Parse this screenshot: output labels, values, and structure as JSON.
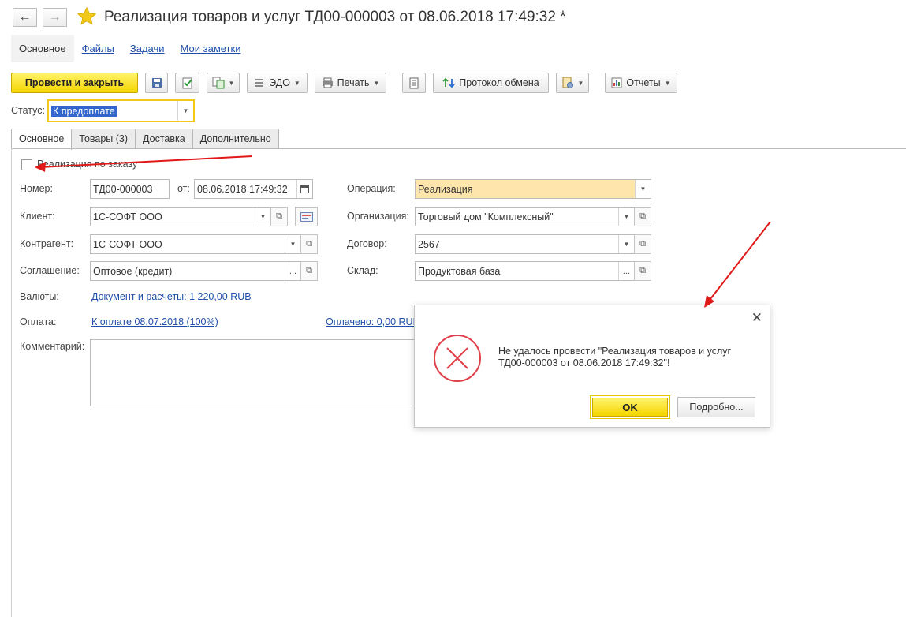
{
  "window": {
    "title": "Реализация товаров и услуг ТД00-000003 от 08.06.2018 17:49:32 *"
  },
  "nav": {
    "back_icon": "arrow-left-icon",
    "forward_icon": "arrow-right-icon",
    "favorite_icon": "star-icon"
  },
  "top_tabs": [
    {
      "label": "Основное",
      "active": true
    },
    {
      "label": "Файлы"
    },
    {
      "label": "Задачи"
    },
    {
      "label": "Мои заметки"
    }
  ],
  "toolbar": {
    "post_close": "Провести и закрыть",
    "edo": "ЭДО",
    "print": "Печать",
    "exchange_log": "Протокол обмена",
    "reports": "Отчеты"
  },
  "status": {
    "label": "Статус:",
    "value": "К предоплате"
  },
  "form_tabs": [
    {
      "label": "Основное",
      "active": true
    },
    {
      "label": "Товары (3)"
    },
    {
      "label": "Доставка"
    },
    {
      "label": "Дополнительно"
    }
  ],
  "form": {
    "by_order_label": "Реализация по заказу",
    "by_order_checked": false,
    "number_label": "Номер:",
    "number_value": "ТД00-000003",
    "from_label": "от:",
    "date_value": "08.06.2018 17:49:32",
    "client_label": "Клиент:",
    "client_value": "1С-СОФТ ООО",
    "counterparty_label": "Контрагент:",
    "counterparty_value": "1С-СОФТ ООО",
    "agreement_label": "Соглашение:",
    "agreement_value": "Оптовое (кредит)",
    "currency_label": "Валюты:",
    "currency_link": "Документ и расчеты: 1 220,00 RUB",
    "payment_label": "Оплата:",
    "payment_link": "К оплате 08.07.2018 (100%)",
    "paid_link": "Оплачено: 0,00 RUB",
    "comment_label": "Комментарий:",
    "comment_value": "",
    "operation_label": "Операция:",
    "operation_value": "Реализация",
    "organization_label": "Организация:",
    "organization_value": "Торговый дом \"Комплексный\"",
    "contract_label": "Договор:",
    "contract_value": "2567",
    "warehouse_label": "Склад:",
    "warehouse_value": "Продуктовая база"
  },
  "dialog": {
    "message_line1": "Не удалось провести \"Реализация товаров и услуг",
    "message_line2": "ТД00-000003 от 08.06.2018 17:49:32\"!",
    "ok": "OK",
    "details": "Подробно..."
  },
  "colors": {
    "accent_yellow": "#f5d500",
    "error_red": "#e0404a",
    "annotation_red": "#e01818",
    "link_blue": "#1f4fa8",
    "operation_bg": "#fde5ac"
  }
}
